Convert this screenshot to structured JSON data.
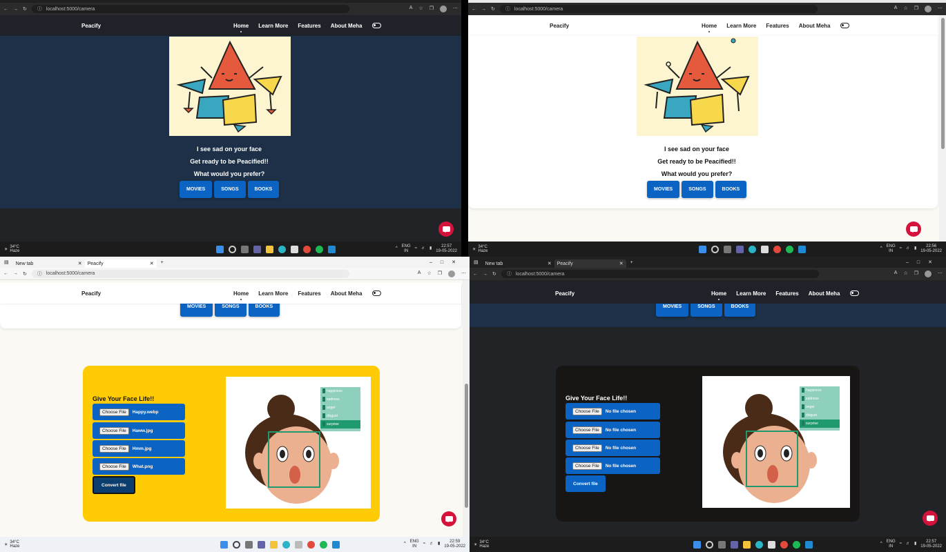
{
  "browser": {
    "url": "localhost:5000/camera",
    "tabs": [
      "New tab",
      "Peacify"
    ]
  },
  "nav": {
    "brand": "Peacify",
    "links": [
      "Home",
      "Learn More",
      "Features",
      "About Meha"
    ]
  },
  "hero": {
    "line1": "I see sad on your face",
    "line2": "Get ready to be Peacified!!",
    "line3": "What would you prefer?",
    "buttons": [
      "MOVIES",
      "SONGS",
      "BOOKS"
    ]
  },
  "upload": {
    "title": "Give Your Face Life!!",
    "choose_label": "Choose File",
    "files_light": [
      "Happy.webp",
      "Haww.jpg",
      "Hmm.jpg",
      "What.png"
    ],
    "files_dark": [
      "No file chosen",
      "No file chosen",
      "No file chosen",
      "No file chosen"
    ],
    "convert_label": "Convert file",
    "emotions": [
      "happiness",
      "sadness",
      "anger",
      "disgust",
      "surprise"
    ],
    "selected_emotion": "surprise"
  },
  "taskbar": {
    "temp": "34°C",
    "weather": "Haze",
    "lang1": "ENG",
    "lang2": "IN",
    "date": "19-05-2022",
    "times": [
      "22:57",
      "22:56",
      "22:59",
      "22:57"
    ]
  },
  "colors": {
    "primary_button": "#0b63c4",
    "dark_bg": "#1d3047",
    "light_bg": "#fbf9f4",
    "upload_card_light": "#ffcb05",
    "upload_card_dark": "#171615",
    "chat": "#d4133c"
  },
  "icons": [
    "back-icon",
    "forward-icon",
    "refresh-icon",
    "info-icon",
    "read-aloud-icon",
    "favorites-icon",
    "collections-icon",
    "profile-icon",
    "more-icon",
    "windows-icon",
    "search-icon",
    "task-view-icon",
    "teams-icon",
    "file-explorer-icon",
    "edge-icon",
    "store-icon",
    "chrome-icon",
    "spotify-icon",
    "vscode-icon",
    "chat-icon",
    "toggle-icon",
    "wifi-icon",
    "volume-icon",
    "battery-icon"
  ]
}
